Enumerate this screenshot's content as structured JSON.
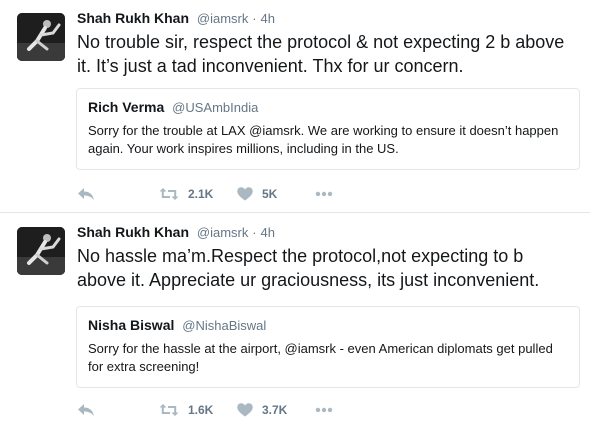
{
  "tweets": [
    {
      "author_name": "Shah Rukh Khan",
      "author_handle": "@iamsrk",
      "separator": "·",
      "time": "4h",
      "text": "No trouble sir, respect the protocol & not expecting 2 b above it. It’s just a tad inconvenient. Thx for ur concern.",
      "quote": {
        "author_name": "Rich Verma",
        "author_handle": "@USAmbIndia",
        "text": "Sorry for the trouble at LAX @iamsrk. We are working to ensure it doesn’t happen again. Your work inspires millions, including in the US."
      },
      "retweets": "2.1K",
      "likes": "5K"
    },
    {
      "author_name": "Shah Rukh Khan",
      "author_handle": "@iamsrk",
      "separator": "·",
      "time": "4h",
      "text": "No hassle ma’m.Respect the protocol,not expecting to b above it. Appreciate ur graciousness, its just inconvenient.",
      "quote": {
        "author_name": "Nisha Biswal",
        "author_handle": "@NishaBiswal",
        "text": "Sorry for the hassle at the airport, @iamsrk - even American diplomats get pulled for extra screening!"
      },
      "retweets": "1.6K",
      "likes": "3.7K"
    }
  ],
  "icons": {
    "reply": "reply-icon",
    "retweet": "retweet-icon",
    "like": "heart-icon",
    "more": "more-icon"
  },
  "colors": {
    "text": "#14171a",
    "secondary": "#657786",
    "border": "#e1e8ed",
    "icon": "#aab8c2"
  }
}
